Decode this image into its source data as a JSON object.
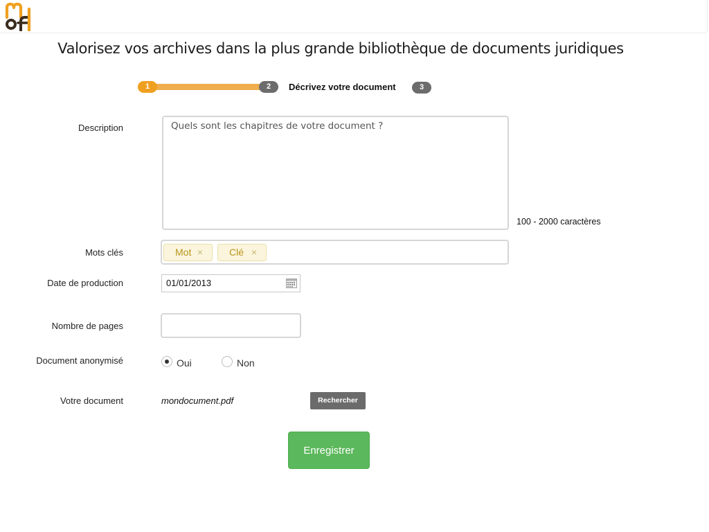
{
  "brand": {
    "logo_name": "mof-logo",
    "accent": "#f0a020"
  },
  "headline": "Valorisez vos archives dans la plus grande bibliothèque de documents juridiques",
  "stepper": {
    "steps": [
      {
        "number": "1",
        "state": "done"
      },
      {
        "number": "2",
        "state": "active",
        "label": "Décrivez votre document"
      },
      {
        "number": "3",
        "state": "pending"
      }
    ]
  },
  "form": {
    "description": {
      "label": "Description",
      "placeholder": "Quels sont les chapitres de votre document ?",
      "hint": "100 - 2000 caractères"
    },
    "keywords": {
      "label": "Mots clés",
      "tags": [
        "Mot",
        "Clé"
      ],
      "remove_icon": "×"
    },
    "production_date": {
      "label": "Date de production",
      "value": "01/01/2013",
      "icon": "calendar-icon"
    },
    "page_count": {
      "label": "Nombre de pages",
      "value": ""
    },
    "anonymized": {
      "label": "Document anonymisé",
      "options": [
        "Oui",
        "Non"
      ],
      "selected": "Oui"
    },
    "document": {
      "label": "Votre document",
      "file_name": "mondocument.pdf",
      "browse_label": "Rechercher"
    },
    "submit_label": "Enregistrer"
  },
  "colors": {
    "step_done": "#f0a020",
    "step_pending": "#6c6c6c",
    "tag_bg": "#fbf5dd",
    "tag_text": "#b8951c",
    "submit": "#5cb85c",
    "browse": "#6b6b6b"
  }
}
